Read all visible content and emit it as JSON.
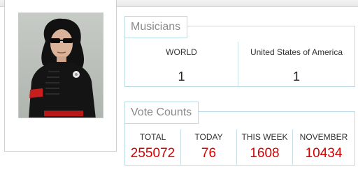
{
  "musicians": {
    "title": "Musicians",
    "columns": [
      {
        "label": "WORLD",
        "value": "1"
      },
      {
        "label": "United States of America",
        "value": "1"
      }
    ]
  },
  "vote_counts": {
    "title": "Vote Counts",
    "columns": [
      {
        "label": "TOTAL",
        "value": "255072"
      },
      {
        "label": "TODAY",
        "value": "76"
      },
      {
        "label": "THIS WEEK",
        "value": "1608"
      },
      {
        "label": "NOVEMBER",
        "value": "10434"
      }
    ],
    "value_color": "#d40000"
  }
}
